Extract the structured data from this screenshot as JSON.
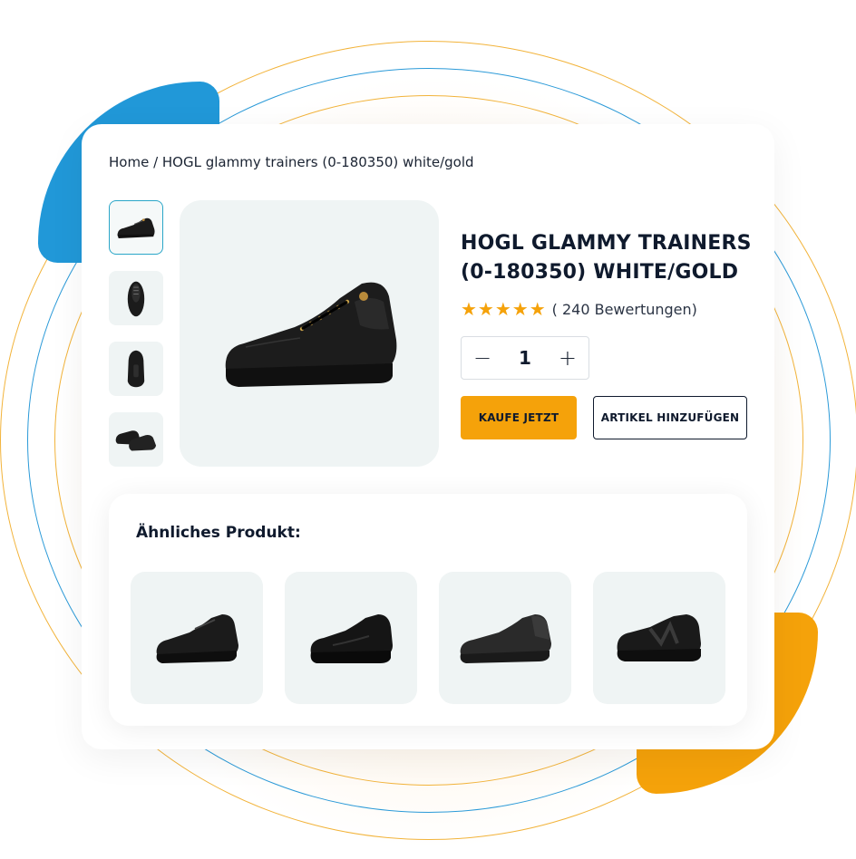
{
  "breadcrumb": "Home / HOGL glammy trainers (0-180350) white/gold",
  "product": {
    "title": "HOGL GLAMMY TRAINERS (0-180350) WHITE/GOLD",
    "rating": 5,
    "stars": "★★★★★",
    "reviews": "( 240 Bewertungen)",
    "quantity": "1",
    "decrement": "−",
    "increment": "+",
    "buy_label": "KAUFE JETZT",
    "add_label": "ARTIKEL HINZUFÜGEN"
  },
  "thumbnails": [
    "side view",
    "top view",
    "back view",
    "pair view"
  ],
  "similar": {
    "title": "Ähnliches Produkt:",
    "items": [
      "black sneaker 1",
      "black sneaker 2",
      "black sneaker 3",
      "black sneaker 4"
    ]
  },
  "colors": {
    "accent": "#f5a20a",
    "blue": "#2198d8",
    "dark": "#0f1a2d",
    "tile": "#eff4f4"
  }
}
